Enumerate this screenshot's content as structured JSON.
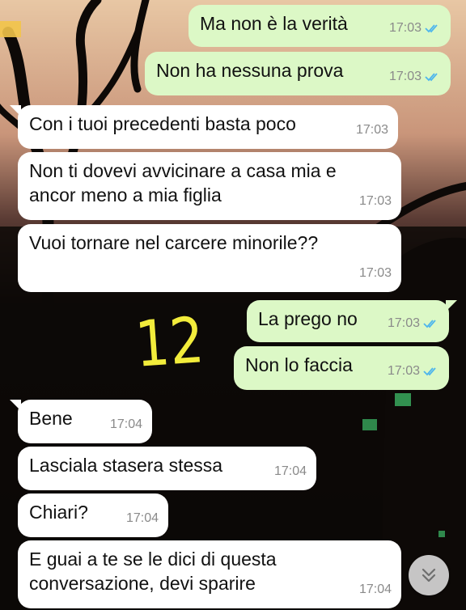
{
  "colors": {
    "incoming_bubble": "#ffffff",
    "outgoing_bubble": "#dcf8c6",
    "read_ticks": "#4fb6ec",
    "annotation": "#f2ec3b",
    "timestamp": "#8a8a8a"
  },
  "messages": [
    {
      "direction": "out",
      "text": "Ma non è la verità",
      "time": "17:03",
      "status": "read"
    },
    {
      "direction": "out",
      "text": "Non ha nessuna prova",
      "time": "17:03",
      "status": "read"
    },
    {
      "direction": "in",
      "text": "Con i tuoi precedenti basta poco",
      "time": "17:03"
    },
    {
      "direction": "in",
      "text": "Non ti dovevi avvicinare a casa mia e ancor meno a mia figlia",
      "line1": "Non ti dovevi avvicinare a casa mia e",
      "line2": "ancor meno a mia figlia",
      "time": "17:03"
    },
    {
      "direction": "in",
      "text": "Vuoi tornare nel carcere minorile??",
      "time": "17:03"
    },
    {
      "direction": "out",
      "text": "La prego no",
      "time": "17:03",
      "status": "read"
    },
    {
      "direction": "out",
      "text": "Non lo faccia",
      "time": "17:03",
      "status": "read"
    },
    {
      "direction": "in",
      "text": "Bene",
      "time": "17:04"
    },
    {
      "direction": "in",
      "text": "Lasciala stasera stessa",
      "time": "17:04"
    },
    {
      "direction": "in",
      "text": "Chiari?",
      "time": "17:04"
    },
    {
      "direction": "in",
      "text": "E guai a te se le dici di questa conversazione, devi sparire",
      "line1": "E guai a te se le dici di questa",
      "line2": "conversazione, devi sparire",
      "time": "17:04"
    }
  ],
  "annotation": {
    "text": "12"
  },
  "scroll_button": {
    "icon": "double-chevron-down-icon"
  }
}
